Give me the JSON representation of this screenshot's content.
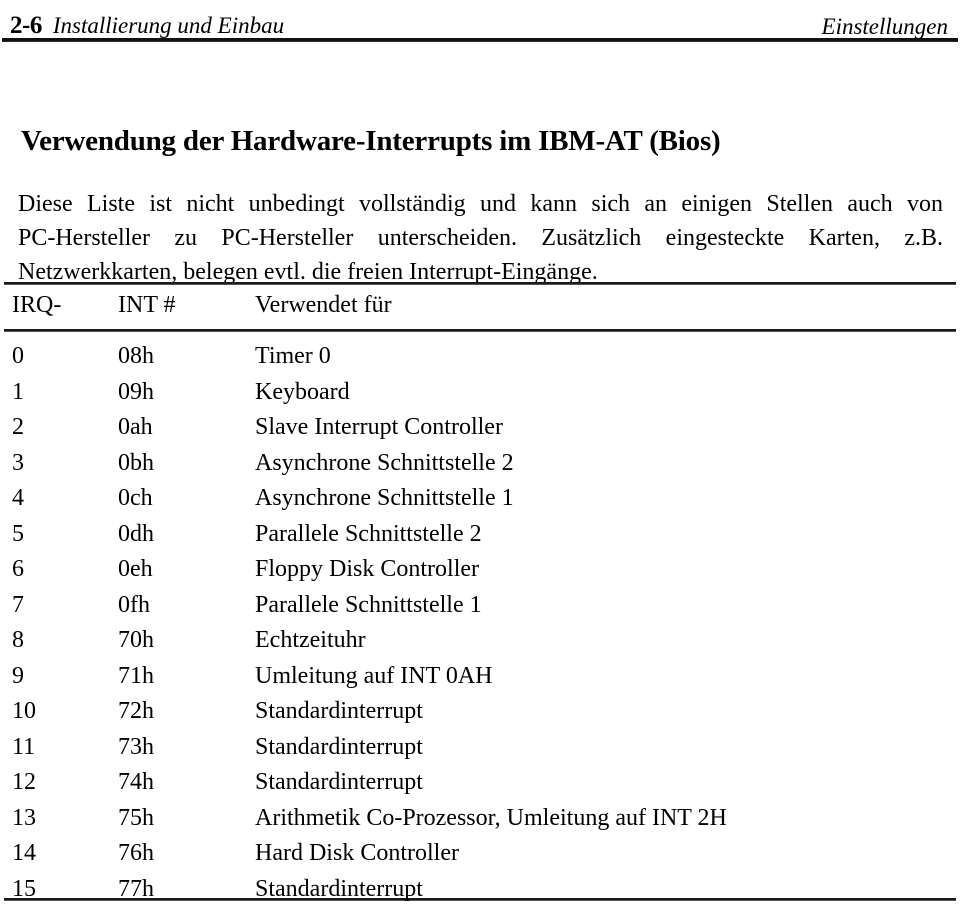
{
  "running_head": {
    "folio": "2-6",
    "chapter": "Installierung und Einbau",
    "section": "Einstellungen"
  },
  "section_title": "Verwendung der Hardware-Interrupts im IBM-AT (Bios)",
  "intro": {
    "line1": "Diese Liste ist nicht unbedingt vollständig und kann sich an einigen Stellen auch von",
    "line2": "PC-Hersteller zu PC-Hersteller unterscheiden. Zusätzlich eingesteckte Karten, z.B.",
    "line3": "Netzwerkkarten, belegen evtl. die freien Interrupt-Eingänge."
  },
  "table": {
    "headers": [
      "IRQ-",
      "INT #",
      "Verwendet für"
    ],
    "rows": [
      {
        "irq": "0",
        "int": "08h",
        "desc": "Timer 0"
      },
      {
        "irq": "1",
        "int": "09h",
        "desc": "Keyboard"
      },
      {
        "irq": "2",
        "int": "0ah",
        "desc": "Slave Interrupt Controller"
      },
      {
        "irq": "3",
        "int": "0bh",
        "desc": "Asynchrone Schnittstelle 2"
      },
      {
        "irq": "4",
        "int": "0ch",
        "desc": "Asynchrone Schnittstelle 1"
      },
      {
        "irq": "5",
        "int": "0dh",
        "desc": "Parallele Schnittstelle 2"
      },
      {
        "irq": "6",
        "int": "0eh",
        "desc": "Floppy Disk Controller"
      },
      {
        "irq": "7",
        "int": "0fh",
        "desc": "Parallele Schnittstelle 1"
      },
      {
        "irq": "8",
        "int": "70h",
        "desc": "Echtzeituhr"
      },
      {
        "irq": "9",
        "int": "71h",
        "desc": "Umleitung auf INT 0AH"
      },
      {
        "irq": "10",
        "int": "72h",
        "desc": "Standardinterrupt"
      },
      {
        "irq": "11",
        "int": "73h",
        "desc": "Standardinterrupt"
      },
      {
        "irq": "12",
        "int": "74h",
        "desc": "Standardinterrupt"
      },
      {
        "irq": "13",
        "int": "75h",
        "desc": "Arithmetik Co-Prozessor, Umleitung auf INT 2H"
      },
      {
        "irq": "14",
        "int": "76h",
        "desc": "Hard Disk Controller"
      },
      {
        "irq": "15",
        "int": "77h",
        "desc": "Standardinterrupt"
      }
    ]
  }
}
